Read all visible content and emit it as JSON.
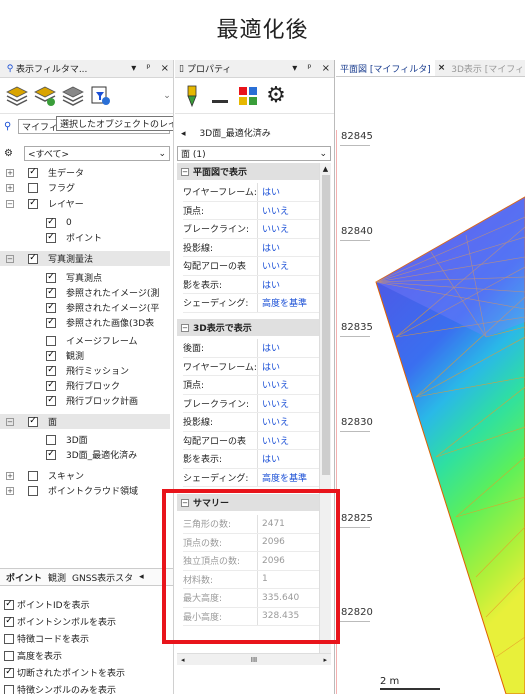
{
  "heading": "最適化後",
  "left": {
    "title": "表示フィルタマ...",
    "filter_value": "マイフィルタ",
    "tooltip": "選択したオブジェクトのレイヤーを非表示にします。",
    "all_option": "<すべて>",
    "tree": [
      {
        "label": "生データ",
        "checked": true,
        "indent": 0,
        "expand": "+"
      },
      {
        "label": "フラグ",
        "checked": false,
        "indent": 0,
        "expand": "+"
      },
      {
        "label": "レイヤー",
        "checked": true,
        "indent": 0,
        "expand": "−"
      },
      {
        "label": "0",
        "checked": true,
        "indent": 1
      },
      {
        "label": "ポイント",
        "checked": true,
        "indent": 1
      },
      {
        "label": "写真測量法",
        "checked": true,
        "indent": 0,
        "expand": "−",
        "group": true
      },
      {
        "label": "写真測点",
        "checked": true,
        "indent": 1
      },
      {
        "label": "参照されたイメージ(測",
        "checked": true,
        "indent": 1
      },
      {
        "label": "参照されたイメージ(平",
        "checked": true,
        "indent": 1
      },
      {
        "label": "参照された画像(3D表",
        "checked": true,
        "indent": 1
      },
      {
        "label": "イメージフレーム",
        "checked": false,
        "indent": 1
      },
      {
        "label": "観測",
        "checked": true,
        "indent": 1
      },
      {
        "label": "飛行ミッション",
        "checked": true,
        "indent": 1
      },
      {
        "label": "飛行ブロック",
        "checked": true,
        "indent": 1
      },
      {
        "label": "飛行ブロック計画",
        "checked": true,
        "indent": 1
      },
      {
        "label": "面",
        "checked": true,
        "indent": 0,
        "expand": "−",
        "group": true
      },
      {
        "label": "3D面",
        "checked": false,
        "indent": 1
      },
      {
        "label": "3D面_最適化済み",
        "checked": true,
        "indent": 1
      },
      {
        "label": "スキャン",
        "checked": false,
        "indent": 0,
        "expand": "+"
      },
      {
        "label": "ポイントクラウド領域",
        "checked": false,
        "indent": 0,
        "expand": "+"
      }
    ],
    "tabs": [
      "ポイント",
      "観測",
      "GNSS表示スタ"
    ],
    "options": [
      {
        "label": "ポイントIDを表示",
        "checked": true
      },
      {
        "label": "ポイントシンボルを表示",
        "checked": true
      },
      {
        "label": "特徴コードを表示",
        "checked": false
      },
      {
        "label": "高度を表示",
        "checked": false
      },
      {
        "label": "切断されたポイントを表示",
        "checked": true
      },
      {
        "label": "特徴シンボルのみを表示",
        "checked": false
      }
    ]
  },
  "props": {
    "title": "プロパティ",
    "object_name": "3D面_最適化済み",
    "count": "面 (1)",
    "sec1": "平面図で表示",
    "sec1_rows": [
      {
        "k": "ワイヤーフレーム:",
        "v": "はい"
      },
      {
        "k": "頂点:",
        "v": "いいえ"
      },
      {
        "k": "ブレークライン:",
        "v": "いいえ"
      },
      {
        "k": "投影線:",
        "v": "はい"
      },
      {
        "k": "勾配アローの表",
        "v": "いいえ"
      },
      {
        "k": "影を表示:",
        "v": "はい"
      },
      {
        "k": "シェーディング:",
        "v": "高度を基準"
      }
    ],
    "sec2": "3D表示で表示",
    "sec2_rows": [
      {
        "k": "後面:",
        "v": "はい"
      },
      {
        "k": "ワイヤーフレーム:",
        "v": "はい"
      },
      {
        "k": "頂点:",
        "v": "いいえ"
      },
      {
        "k": "ブレークライン:",
        "v": "いいえ"
      },
      {
        "k": "投影線:",
        "v": "いいえ"
      },
      {
        "k": "勾配アローの表",
        "v": "いいえ"
      },
      {
        "k": "影を表示:",
        "v": "はい"
      },
      {
        "k": "シェーディング:",
        "v": "高度を基準"
      }
    ],
    "sec3": "サマリー",
    "sec3_rows": [
      {
        "k": "三角形の数:",
        "v": "2471"
      },
      {
        "k": "頂点の数:",
        "v": "2096"
      },
      {
        "k": "独立頂点の数:",
        "v": "2096"
      },
      {
        "k": "材料数:",
        "v": "1"
      },
      {
        "k": "最大高度:",
        "v": "335.640"
      },
      {
        "k": "最小高度:",
        "v": "328.435"
      }
    ],
    "scroll_label": "III"
  },
  "view": {
    "tab_active": "平面図 [マイフィルタ]",
    "tab_inactive": "3D表示 [マイフィ",
    "close": "×",
    "y_ticks": [
      "82845",
      "82840",
      "82835",
      "82830",
      "82825",
      "82820"
    ],
    "scale": "2 m"
  },
  "colors": {
    "highlight": "#e8141b",
    "accent": "#1a4fd6"
  }
}
